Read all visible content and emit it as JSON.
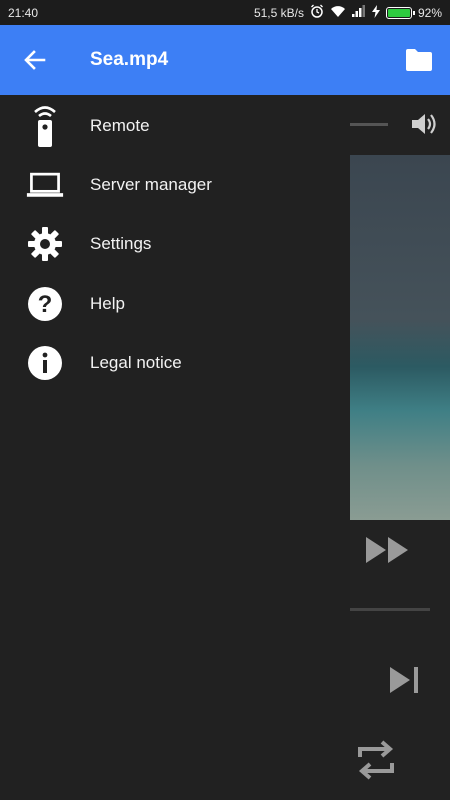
{
  "status_bar": {
    "time": "21:40",
    "network_speed": "51,5 kB/s",
    "battery_percent": "92%",
    "battery_level": 0.92,
    "icons": [
      "alarm-icon",
      "wifi-icon",
      "signal-icon",
      "charging-icon",
      "battery-icon"
    ]
  },
  "app_bar": {
    "title": "Sea.mp4",
    "back_icon": "arrow-back-icon",
    "action_icon": "folder-icon",
    "color": "#3d7ff5"
  },
  "drawer": {
    "items": [
      {
        "label": "Remote",
        "icon": "remote-icon"
      },
      {
        "label": "Server manager",
        "icon": "laptop-icon"
      },
      {
        "label": "Settings",
        "icon": "gear-icon"
      },
      {
        "label": "Help",
        "icon": "help-icon"
      },
      {
        "label": "Legal notice",
        "icon": "info-icon"
      }
    ]
  },
  "player": {
    "controls": [
      "volume-icon",
      "fast-forward-icon",
      "skip-next-icon",
      "repeat-icon"
    ]
  }
}
